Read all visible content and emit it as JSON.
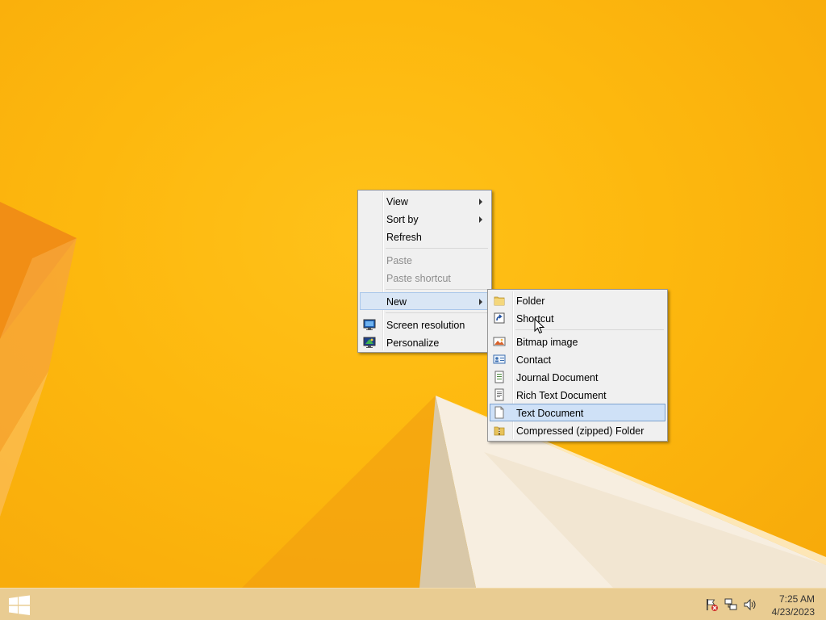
{
  "context_menu": {
    "items": [
      {
        "label": "View",
        "has_submenu": true
      },
      {
        "label": "Sort by",
        "has_submenu": true
      },
      {
        "label": "Refresh"
      },
      {
        "label": "Paste",
        "disabled": true
      },
      {
        "label": "Paste shortcut",
        "disabled": true
      },
      {
        "label": "New",
        "has_submenu": true,
        "highlighted": true
      },
      {
        "label": "Screen resolution",
        "icon": "screen-resolution-icon"
      },
      {
        "label": "Personalize",
        "icon": "personalize-icon"
      }
    ]
  },
  "new_submenu": {
    "items": [
      {
        "label": "Folder",
        "icon": "folder-icon"
      },
      {
        "label": "Shortcut",
        "icon": "shortcut-icon"
      },
      {
        "label": "Bitmap image",
        "icon": "bitmap-image-icon"
      },
      {
        "label": "Contact",
        "icon": "contact-icon"
      },
      {
        "label": "Journal Document",
        "icon": "journal-document-icon"
      },
      {
        "label": "Rich Text Document",
        "icon": "rich-text-document-icon"
      },
      {
        "label": "Text Document",
        "icon": "text-document-icon",
        "highlighted": true
      },
      {
        "label": "Compressed (zipped) Folder",
        "icon": "zipped-folder-icon"
      }
    ]
  },
  "taskbar": {
    "start_icon": "windows-logo-icon",
    "tray_icons": [
      "action-center-flag-icon",
      "network-icon",
      "volume-icon"
    ],
    "clock": {
      "time": "7:25 AM",
      "date": "4/23/2023"
    }
  },
  "colors": {
    "wallpaper": "#fdb80e",
    "taskbar": "#e9cc92",
    "menu_bg": "#f0f0f0",
    "highlight": "#d9e6f5"
  }
}
